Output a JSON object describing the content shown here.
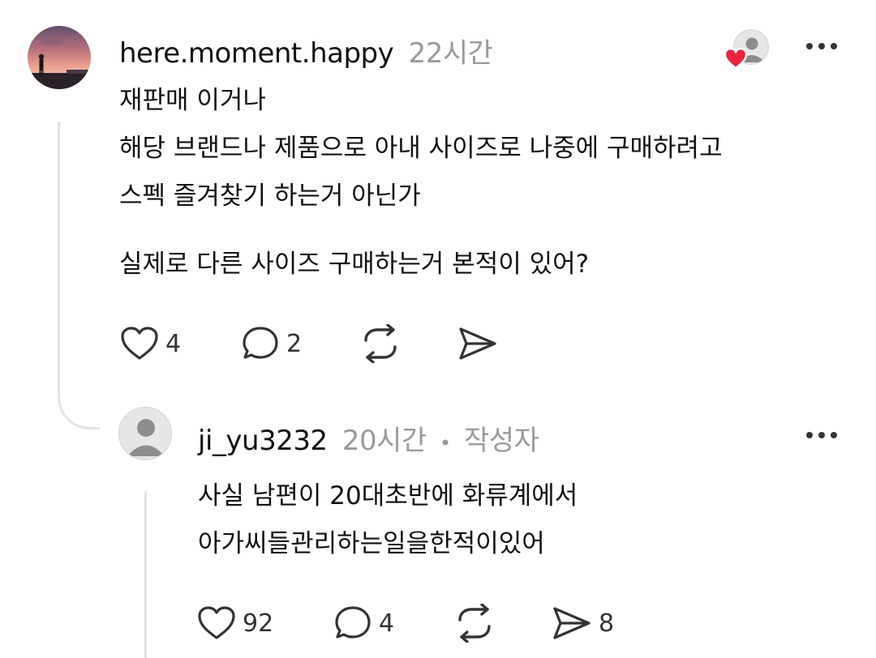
{
  "post": {
    "username": "here.moment.happy",
    "time": "22시간",
    "body": {
      "lines": [
        "재판매 이거나",
        "해당 브랜드나 제품으로 아내 사이즈로 나중에 구매하려고",
        "스펙 즐겨찾기 하는거 아닌가"
      ],
      "question": "실제로 다른 사이즈 구매하는거 본적이 있어?"
    },
    "actions": {
      "like_count": "4",
      "reply_count": "2"
    }
  },
  "reply": {
    "username": "ji_yu3232",
    "time": "20시간",
    "separator": "•",
    "author_badge": "작성자",
    "body": {
      "lines": [
        "사실 남편이 20대초반에 화류계에서",
        "아가씨들관리하는일을한적이있어"
      ]
    },
    "actions": {
      "like_count": "92",
      "reply_count": "4",
      "share_count": "8"
    }
  },
  "icons": {
    "like": "heart-icon",
    "reply": "comment-icon",
    "repost": "repost-icon",
    "share": "send-icon",
    "more": "more-icon",
    "liked_by": "liked-by-author-icon"
  },
  "colors": {
    "heart_badge": "#e8243c",
    "meta_text": "#9a9a9a",
    "thread_line": "#e3e3e3"
  }
}
